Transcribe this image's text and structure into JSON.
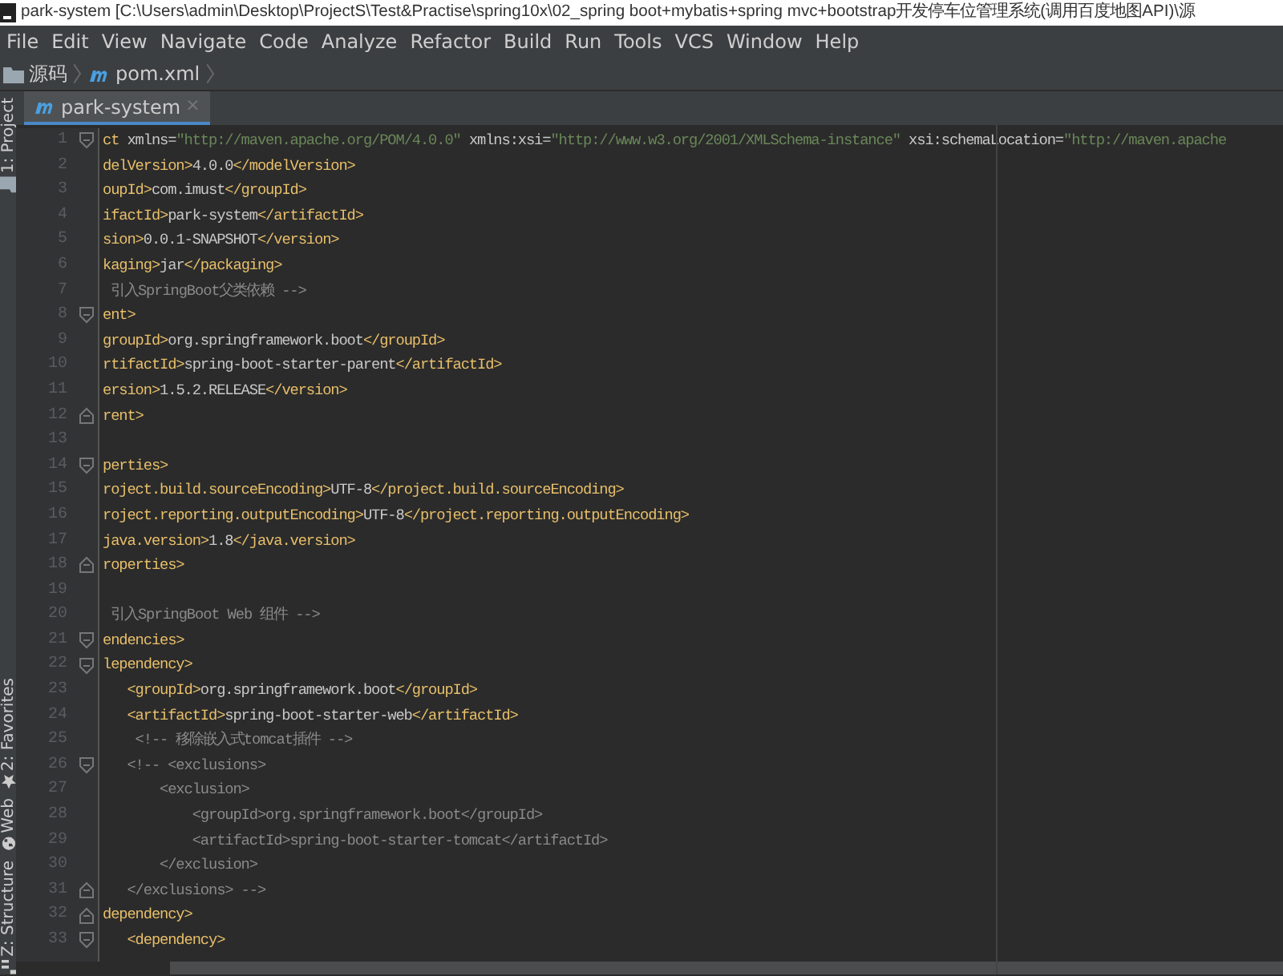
{
  "window": {
    "title": "park-system [C:\\Users\\admin\\Desktop\\ProjectS\\Test&Practise\\spring10x\\02_spring boot+mybatis+spring mvc+bootstrap开发停车位管理系统(调用百度地图API)\\源"
  },
  "menu": [
    "File",
    "Edit",
    "View",
    "Navigate",
    "Code",
    "Analyze",
    "Refactor",
    "Build",
    "Run",
    "Tools",
    "VCS",
    "Window",
    "Help"
  ],
  "breadcrumb": [
    {
      "kind": "folder",
      "label": "源码"
    },
    {
      "kind": "maven",
      "label": "pom.xml"
    }
  ],
  "tabs": [
    {
      "label": "park-system",
      "selected": true,
      "close": "×"
    }
  ],
  "tool_windows": [
    {
      "kind": "folder",
      "label": "1: Project"
    },
    {
      "kind": "star",
      "label": "2: Favorites"
    },
    {
      "kind": "globe",
      "label": "Web"
    },
    {
      "kind": "structure",
      "label": "Z: Structure"
    }
  ],
  "editor": {
    "lines": [
      {
        "number": "1",
        "kind": "opener",
        "segments": [
          {
            "kind": "tag",
            "text": "ct "
          },
          {
            "kind": "attr",
            "text": "xmlns="
          },
          {
            "kind": "string",
            "text": "\"http://maven.apache.org/POM/4.0.0\""
          },
          {
            "kind": "attr",
            "text": " xmlns:xsi="
          },
          {
            "kind": "string",
            "text": "\"http://www.w3.org/2001/XMLSchema-instance\""
          },
          {
            "kind": "attr",
            "text": " xsi:schemaLocation="
          },
          {
            "kind": "string",
            "text": "\"http://maven.apache"
          }
        ]
      },
      {
        "number": "2",
        "kind": "plain",
        "segments": [
          {
            "kind": "tag",
            "text": "delVersion>"
          },
          {
            "kind": "text",
            "text": "4.0.0"
          },
          {
            "kind": "tag",
            "text": "</modelVersion>"
          }
        ]
      },
      {
        "number": "3",
        "kind": "plain",
        "segments": [
          {
            "kind": "tag",
            "text": "oupId>"
          },
          {
            "kind": "text",
            "text": "com.imust"
          },
          {
            "kind": "tag",
            "text": "</groupId>"
          }
        ]
      },
      {
        "number": "4",
        "kind": "plain",
        "segments": [
          {
            "kind": "tag",
            "text": "ifactId>"
          },
          {
            "kind": "text",
            "text": "park-system"
          },
          {
            "kind": "tag",
            "text": "</artifactId>"
          }
        ]
      },
      {
        "number": "5",
        "kind": "plain",
        "segments": [
          {
            "kind": "tag",
            "text": "sion>"
          },
          {
            "kind": "text",
            "text": "0.0.1-SNAPSHOT"
          },
          {
            "kind": "tag",
            "text": "</version>"
          }
        ]
      },
      {
        "number": "6",
        "kind": "plain",
        "segments": [
          {
            "kind": "tag",
            "text": "kaging>"
          },
          {
            "kind": "text",
            "text": "jar"
          },
          {
            "kind": "tag",
            "text": "</packaging>"
          }
        ]
      },
      {
        "number": "7",
        "kind": "plain",
        "segments": [
          {
            "kind": "comment",
            "text": " 引入SpringBoot父类依赖 -->"
          }
        ]
      },
      {
        "number": "8",
        "kind": "opener",
        "segments": [
          {
            "kind": "tag",
            "text": "ent>"
          }
        ]
      },
      {
        "number": "9",
        "kind": "plain",
        "segments": [
          {
            "kind": "tag",
            "text": "groupId>"
          },
          {
            "kind": "text",
            "text": "org.springframework.boot"
          },
          {
            "kind": "tag",
            "text": "</groupId>"
          }
        ]
      },
      {
        "number": "10",
        "kind": "plain",
        "segments": [
          {
            "kind": "tag",
            "text": "rtifactId>"
          },
          {
            "kind": "text",
            "text": "spring-boot-starter-parent"
          },
          {
            "kind": "tag",
            "text": "</artifactId>"
          }
        ]
      },
      {
        "number": "11",
        "kind": "plain",
        "segments": [
          {
            "kind": "tag",
            "text": "ersion>"
          },
          {
            "kind": "text",
            "text": "1.5.2.RELEASE"
          },
          {
            "kind": "tag",
            "text": "</version>"
          }
        ]
      },
      {
        "number": "12",
        "kind": "closer",
        "segments": [
          {
            "kind": "tag",
            "text": "rent>"
          }
        ]
      },
      {
        "number": "13",
        "kind": "plain"
      },
      {
        "number": "14",
        "kind": "opener",
        "segments": [
          {
            "kind": "tag",
            "text": "perties>"
          }
        ]
      },
      {
        "number": "15",
        "kind": "plain",
        "segments": [
          {
            "kind": "tag",
            "text": "roject.build.sourceEncoding>"
          },
          {
            "kind": "text",
            "text": "UTF-8"
          },
          {
            "kind": "tag",
            "text": "</project.build.sourceEncoding>"
          }
        ]
      },
      {
        "number": "16",
        "kind": "plain",
        "segments": [
          {
            "kind": "tag",
            "text": "roject.reporting.outputEncoding>"
          },
          {
            "kind": "text",
            "text": "UTF-8"
          },
          {
            "kind": "tag",
            "text": "</project.reporting.outputEncoding>"
          }
        ]
      },
      {
        "number": "17",
        "kind": "plain",
        "segments": [
          {
            "kind": "tag",
            "text": "java.version>"
          },
          {
            "kind": "text",
            "text": "1.8"
          },
          {
            "kind": "tag",
            "text": "</java.version>"
          }
        ]
      },
      {
        "number": "18",
        "kind": "closer",
        "segments": [
          {
            "kind": "tag",
            "text": "roperties>"
          }
        ]
      },
      {
        "number": "19",
        "kind": "plain"
      },
      {
        "number": "20",
        "kind": "plain",
        "segments": [
          {
            "kind": "comment",
            "text": " 引入SpringBoot Web 组件 -->"
          }
        ]
      },
      {
        "number": "21",
        "kind": "opener",
        "segments": [
          {
            "kind": "tag",
            "text": "endencies>"
          }
        ]
      },
      {
        "number": "22",
        "kind": "opener",
        "segments": [
          {
            "kind": "tag",
            "text": "lependency>"
          }
        ]
      },
      {
        "number": "23",
        "kind": "plain",
        "segments": [
          {
            "kind": "tag",
            "text": "   <groupId>"
          },
          {
            "kind": "text",
            "text": "org.springframework.boot"
          },
          {
            "kind": "tag",
            "text": "</groupId>"
          }
        ]
      },
      {
        "number": "24",
        "kind": "plain",
        "segments": [
          {
            "kind": "tag",
            "text": "   <artifactId>"
          },
          {
            "kind": "text",
            "text": "spring-boot-starter-web"
          },
          {
            "kind": "tag",
            "text": "</artifactId>"
          }
        ]
      },
      {
        "number": "25",
        "kind": "plain",
        "segments": [
          {
            "kind": "comment",
            "text": "    <!-- 移除嵌入式tomcat插件 -->"
          }
        ]
      },
      {
        "number": "26",
        "kind": "opener",
        "segments": [
          {
            "kind": "comment",
            "text": "   <!-- <exclusions>"
          }
        ]
      },
      {
        "number": "27",
        "kind": "plain",
        "segments": [
          {
            "kind": "comment",
            "text": "       <exclusion>"
          }
        ]
      },
      {
        "number": "28",
        "kind": "plain",
        "segments": [
          {
            "kind": "comment",
            "text": "           <groupId>org.springframework.boot</groupId>"
          }
        ]
      },
      {
        "number": "29",
        "kind": "plain",
        "segments": [
          {
            "kind": "comment",
            "text": "           <artifactId>spring-boot-starter-tomcat</artifactId>"
          }
        ]
      },
      {
        "number": "30",
        "kind": "plain",
        "segments": [
          {
            "kind": "comment",
            "text": "       </exclusion>"
          }
        ]
      },
      {
        "number": "31",
        "kind": "closer",
        "segments": [
          {
            "kind": "comment",
            "text": "   </exclusions> -->"
          }
        ]
      },
      {
        "number": "32",
        "kind": "closer",
        "segments": [
          {
            "kind": "tag",
            "text": "dependency>"
          }
        ]
      },
      {
        "number": "33",
        "kind": "opener",
        "segments": [
          {
            "kind": "tag",
            "text": "   <dependency>"
          }
        ]
      }
    ]
  }
}
